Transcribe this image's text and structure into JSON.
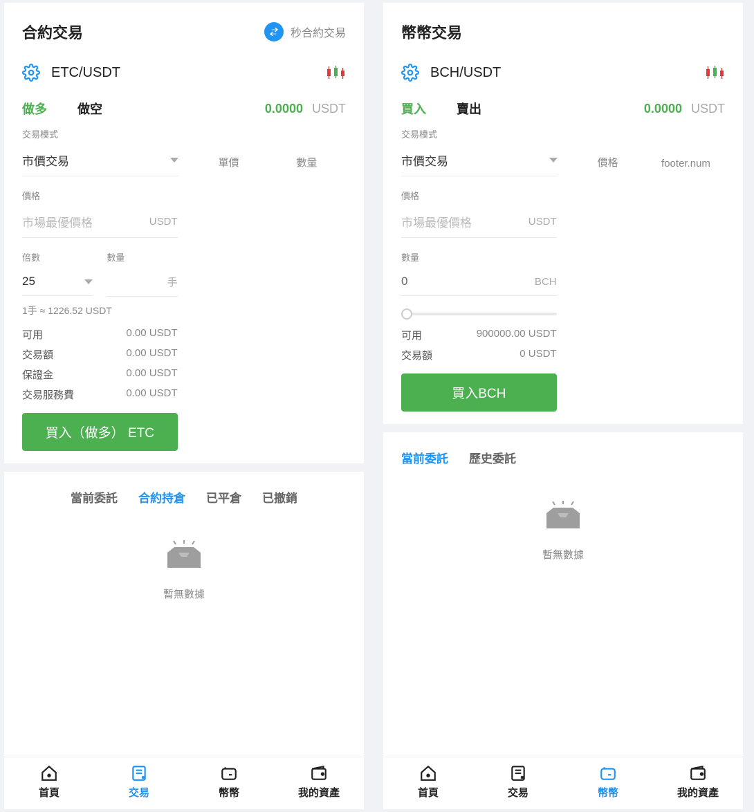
{
  "left": {
    "title": "合約交易",
    "swap_label": "秒合約交易",
    "pair": "ETC/USDT",
    "tabs": {
      "long": "做多",
      "short": "做空"
    },
    "price_value": "0.0000",
    "price_unit": "USDT",
    "mode_label": "交易模式",
    "mode_value": "市價交易",
    "col_price": "單價",
    "col_qty": "數量",
    "price_label": "價格",
    "price_placeholder": "市場最優價格",
    "price_input_unit": "USDT",
    "lev_label": "倍數",
    "lev_value": "25",
    "qty_label": "數量",
    "qty_unit": "手",
    "lot_note": "1手 ≈ 1226.52 USDT",
    "rows": [
      {
        "k": "可用",
        "v": "0.00 USDT"
      },
      {
        "k": "交易額",
        "v": "0.00 USDT"
      },
      {
        "k": "保證金",
        "v": "0.00 USDT"
      },
      {
        "k": "交易服務費",
        "v": "0.00 USDT"
      }
    ],
    "submit": "買入（做多） ETC",
    "sub_tabs": [
      "當前委託",
      "合約持倉",
      "已平倉",
      "已撤銷"
    ],
    "sub_active": 1,
    "empty": "暫無數據"
  },
  "right": {
    "title": "幣幣交易",
    "pair": "BCH/USDT",
    "tabs": {
      "buy": "買入",
      "sell": "賣出"
    },
    "price_value": "0.0000",
    "price_unit": "USDT",
    "mode_label": "交易模式",
    "mode_value": "市價交易",
    "col_price": "價格",
    "col_qty": "footer.num",
    "price_label": "價格",
    "price_placeholder": "市場最優價格",
    "price_input_unit": "USDT",
    "qty_label": "數量",
    "qty_value": "0",
    "qty_unit": "BCH",
    "rows": [
      {
        "k": "可用",
        "v": "900000.00 USDT"
      },
      {
        "k": "交易額",
        "v": "0 USDT"
      }
    ],
    "submit": "買入BCH",
    "sub_tabs": [
      "當前委託",
      "歷史委託"
    ],
    "sub_active": 0,
    "empty": "暫無數據"
  },
  "footer": {
    "home": "首頁",
    "trade": "交易",
    "coin": "幣幣",
    "assets": "我的資產"
  }
}
